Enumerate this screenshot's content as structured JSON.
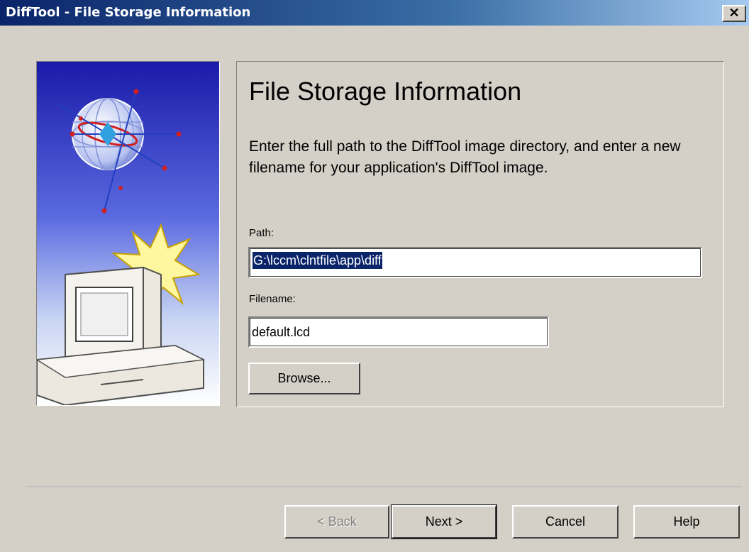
{
  "window": {
    "title": "DiffTool - File Storage Information",
    "close_glyph": "✕"
  },
  "page": {
    "heading": "File Storage Information",
    "description": "Enter the full path to the DiffTool image directory, and enter a new filename for your application's DiffTool image."
  },
  "form": {
    "path_label": "Path:",
    "path_value": "G:\\lccm\\clntfile\\app\\diff",
    "filename_label": "Filename:",
    "filename_value": "default.lcd",
    "browse_label": "Browse..."
  },
  "buttons": {
    "back_label": "< Back",
    "next_label": "Next >",
    "cancel_label": "Cancel",
    "help_label": "Help"
  },
  "colors": {
    "title_bar": "#0a246a",
    "face": "#d4d0c8",
    "selection": "#0a246a"
  }
}
